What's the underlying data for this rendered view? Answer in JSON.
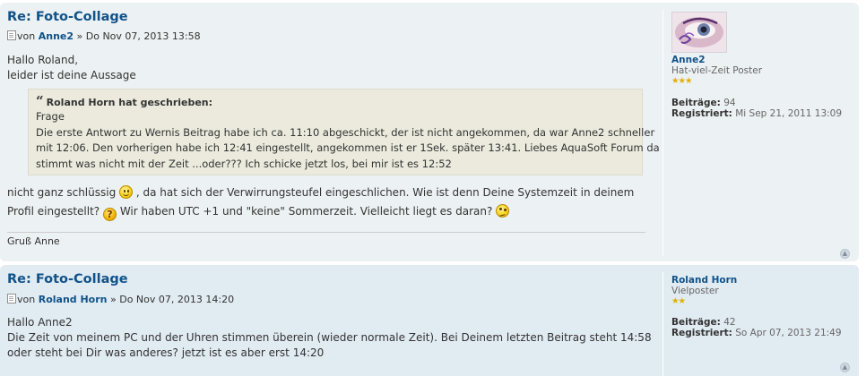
{
  "posts": [
    {
      "title": "Re: Foto-Collage",
      "meta": {
        "prefix": "von",
        "author": "Anne2",
        "separator": "»",
        "date": "Do Nov 07, 2013 13:58"
      },
      "body_before_quote": [
        "Hallo Roland,",
        "leider ist deine Aussage"
      ],
      "quote": {
        "cite": "Roland Horn hat geschrieben:",
        "lines": [
          "Frage",
          "Die erste Antwort zu Wernis Beitrag habe ich ca. 11:10 abgeschickt, der ist nicht angekommen, da war Anne2 schneller",
          "mit 12:06. Den vorherigen habe ich 12:41 eingestellt, angekommen ist er 1Sek. später 13:41. Liebes AquaSoft Forum da",
          "stimmt was nicht mit der Zeit ...oder??? Ich schicke jetzt los, bei mir ist es 12:52"
        ]
      },
      "body_after_quote": {
        "l1a": "nicht ganz schlüssig",
        "l1b": ", da hat sich der Verwirrungsteufel eingeschlichen. Wie ist denn Deine Systemzeit in deinem",
        "l2a": "Profil eingestellt?",
        "l2b": "Wir haben UTC +1 und \"keine\" Sommerzeit. Vielleicht liegt es daran?"
      },
      "signature": "Gruß Anne",
      "profile": {
        "name": "Anne2",
        "rank": "Hat-viel-Zeit Poster",
        "stars": "★★★",
        "posts_label": "Beiträge:",
        "posts_value": "94",
        "registered_label": "Registriert:",
        "registered_value": "Mi Sep 21, 2011 13:09"
      }
    },
    {
      "title": "Re: Foto-Collage",
      "meta": {
        "prefix": "von",
        "author": "Roland Horn",
        "separator": "»",
        "date": "Do Nov 07, 2013 14:20"
      },
      "body": [
        "Hallo Anne2",
        "Die Zeit von meinem PC und der Uhren stimmen überein (wieder normale Zeit). Bei Deinem letzten Beitrag steht 14:58",
        "oder steht bei Dir was anderes? jetzt ist es aber erst 14:20"
      ],
      "profile": {
        "name": "Roland Horn",
        "rank": "Vielposter",
        "stars": "★★",
        "posts_label": "Beiträge:",
        "posts_value": "42",
        "registered_label": "Registriert:",
        "registered_value": "So Apr 07, 2013 21:49"
      }
    }
  ],
  "icons": {
    "top": "top-arrow-icon",
    "post": "post-icon",
    "smile": "smile-icon",
    "question": "question-icon",
    "confused": "confused-icon"
  },
  "colors": {
    "post_bg_1": "#ECF1F3",
    "post_bg_2": "#e1ebf2",
    "link": "#105289",
    "quote_bg": "#EBEADD"
  }
}
